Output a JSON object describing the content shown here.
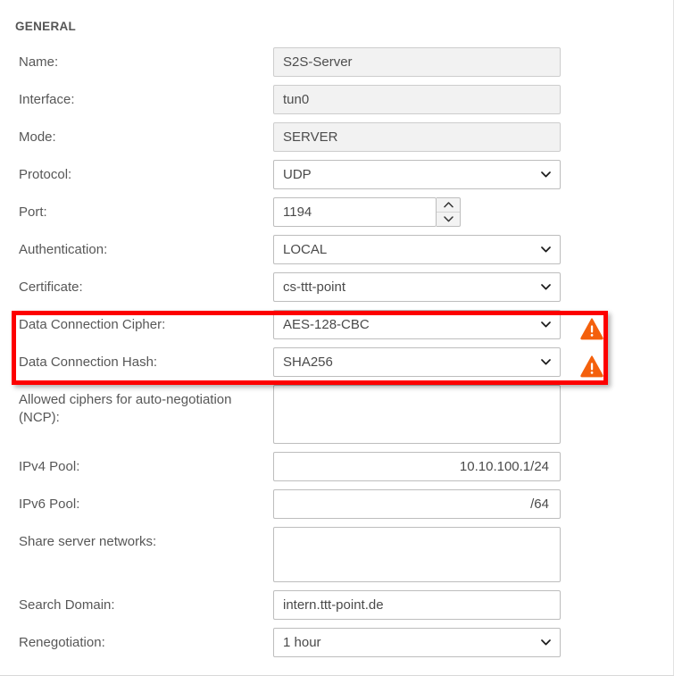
{
  "section": {
    "title": "GENERAL"
  },
  "highlight": {
    "color": "#fd0000"
  },
  "warning": {
    "color": "#f4600c",
    "icon": "warning-triangle-icon",
    "glyph": "!"
  },
  "fields": [
    {
      "label": "Name:",
      "type": "text-readonly",
      "value": "S2S-Server",
      "name": "name"
    },
    {
      "label": "Interface:",
      "type": "text-readonly",
      "value": "tun0",
      "name": "interface"
    },
    {
      "label": "Mode:",
      "type": "text-readonly",
      "value": "SERVER",
      "name": "mode"
    },
    {
      "label": "Protocol:",
      "type": "select",
      "value": "UDP",
      "name": "protocol"
    },
    {
      "label": "Port:",
      "type": "number",
      "value": "1194",
      "name": "port"
    },
    {
      "label": "Authentication:",
      "type": "select",
      "value": "LOCAL",
      "name": "authentication"
    },
    {
      "label": "Certificate:",
      "type": "select",
      "value": "cs-ttt-point",
      "name": "certificate"
    },
    {
      "label": "Data Connection Cipher:",
      "type": "select",
      "value": "AES-128-CBC",
      "name": "data-connection-cipher",
      "warning": true
    },
    {
      "label": "Data Connection Hash:",
      "type": "select",
      "value": "SHA256",
      "name": "data-connection-hash",
      "warning": true
    },
    {
      "label": "Allowed ciphers for auto-negotiation\n(NCP):",
      "type": "textarea",
      "value": "",
      "name": "allowed-ciphers-ncp"
    },
    {
      "label": "IPv4 Pool:",
      "type": "text-right",
      "value": "10.10.100.1/24",
      "name": "ipv4-pool"
    },
    {
      "label": "IPv6 Pool:",
      "type": "text-right",
      "value": "/64",
      "name": "ipv6-pool"
    },
    {
      "label": "Share server networks:",
      "type": "textarea",
      "value": "",
      "name": "share-server-networks"
    },
    {
      "label": "Search Domain:",
      "type": "text",
      "value": "intern.ttt-point.de",
      "name": "search-domain"
    },
    {
      "label": "Renegotiation:",
      "type": "select",
      "value": "1 hour",
      "name": "renegotiation"
    }
  ]
}
